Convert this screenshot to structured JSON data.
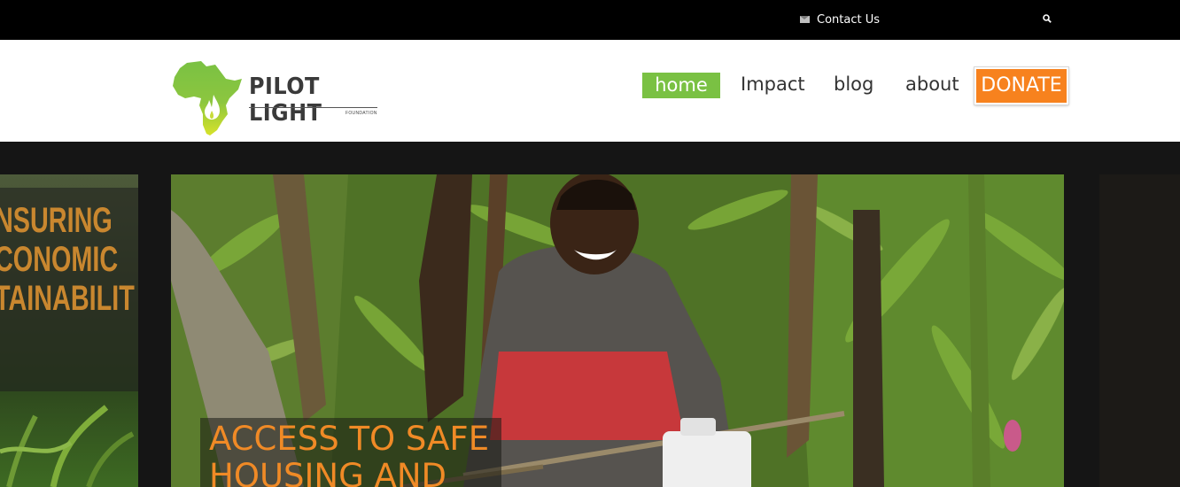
{
  "topbar": {
    "contact_label": "Contact Us",
    "contact_icon": "envelope-icon",
    "search_icon": "search-icon"
  },
  "logo": {
    "name": "PILOT LIGHT",
    "sub": "FOUNDATION",
    "icon": "africa-flame-icon"
  },
  "nav": {
    "items": [
      {
        "label": "home",
        "active": true
      },
      {
        "label": "Impact"
      },
      {
        "label": "blog"
      },
      {
        "label": "about"
      }
    ],
    "donate_label": "DONATE"
  },
  "slider": {
    "prev_slide_text": [
      "NSURING",
      "CONOMIC",
      "TAINABILIT"
    ],
    "current_caption": [
      "ACCESS TO SAFE",
      "HOUSING AND"
    ]
  },
  "colors": {
    "accent_green": "#7ac143",
    "donate_orange": "#f7821e",
    "caption_orange": "#f08a26"
  }
}
